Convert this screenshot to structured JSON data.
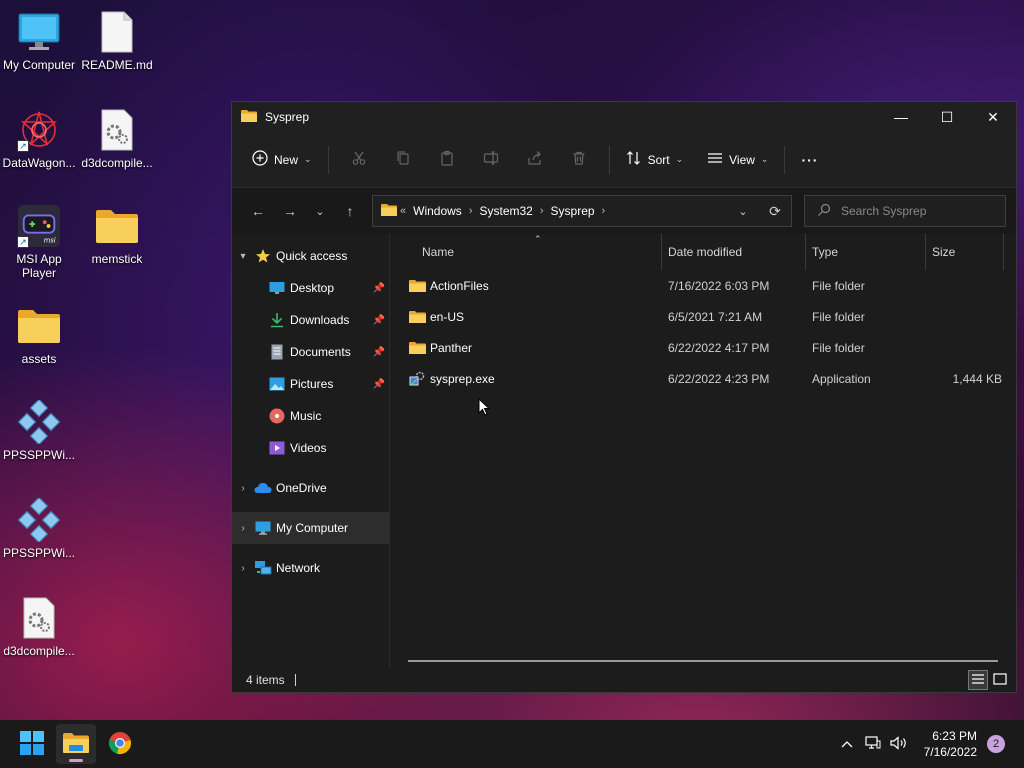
{
  "desktop": {
    "icons": [
      {
        "label": "My Computer",
        "icon": "monitor-icon"
      },
      {
        "label": "README.md",
        "icon": "document-icon"
      },
      {
        "label": "DataWagon...",
        "icon": "app-shortcut-icon"
      },
      {
        "label": "d3dcompile...",
        "icon": "settings-file-icon"
      },
      {
        "label": "MSI App\nPlayer",
        "icon": "gamepad-icon"
      },
      {
        "label": "memstick",
        "icon": "folder-icon"
      },
      {
        "label": "assets",
        "icon": "folder-icon"
      },
      {
        "label": "PPSSPPWi...",
        "icon": "ppsspp-icon"
      },
      {
        "label": "PPSSPPWi...",
        "icon": "ppsspp-icon"
      },
      {
        "label": "d3dcompile...",
        "icon": "settings-file-icon"
      }
    ]
  },
  "window": {
    "title": "Sysprep",
    "controls": {
      "minimize": "—",
      "maximize": "☐",
      "close": "✕"
    }
  },
  "commandbar": {
    "new_label": "New",
    "sort_label": "Sort",
    "view_label": "View",
    "more_label": "···"
  },
  "address": {
    "overflow": "«",
    "crumbs": [
      "Windows",
      "System32",
      "Sysprep"
    ],
    "search_placeholder": "Search Sysprep"
  },
  "navpane": {
    "quick_access": "Quick access",
    "quick_items": [
      {
        "label": "Desktop",
        "pinned": true
      },
      {
        "label": "Downloads",
        "pinned": true
      },
      {
        "label": "Documents",
        "pinned": true
      },
      {
        "label": "Pictures",
        "pinned": true
      },
      {
        "label": "Music",
        "pinned": false
      },
      {
        "label": "Videos",
        "pinned": false
      }
    ],
    "onedrive": "OneDrive",
    "my_computer": "My Computer",
    "network": "Network"
  },
  "filelist": {
    "columns": {
      "name": "Name",
      "date": "Date modified",
      "type": "Type",
      "size": "Size"
    },
    "rows": [
      {
        "name": "ActionFiles",
        "date": "7/16/2022 6:03 PM",
        "type": "File folder",
        "size": ""
      },
      {
        "name": "en-US",
        "date": "6/5/2021 7:21 AM",
        "type": "File folder",
        "size": ""
      },
      {
        "name": "Panther",
        "date": "6/22/2022 4:17 PM",
        "type": "File folder",
        "size": ""
      },
      {
        "name": "sysprep.exe",
        "date": "6/22/2022 4:23 PM",
        "type": "Application",
        "size": "1,444 KB"
      }
    ]
  },
  "status": {
    "items": "4 items"
  },
  "taskbar": {
    "clock_time": "6:23 PM",
    "clock_date": "7/16/2022",
    "notifications": "2"
  },
  "colors": {
    "folder": "#f4c542",
    "accent": "#0a84ff",
    "window_bg": "#1c1c1c"
  }
}
